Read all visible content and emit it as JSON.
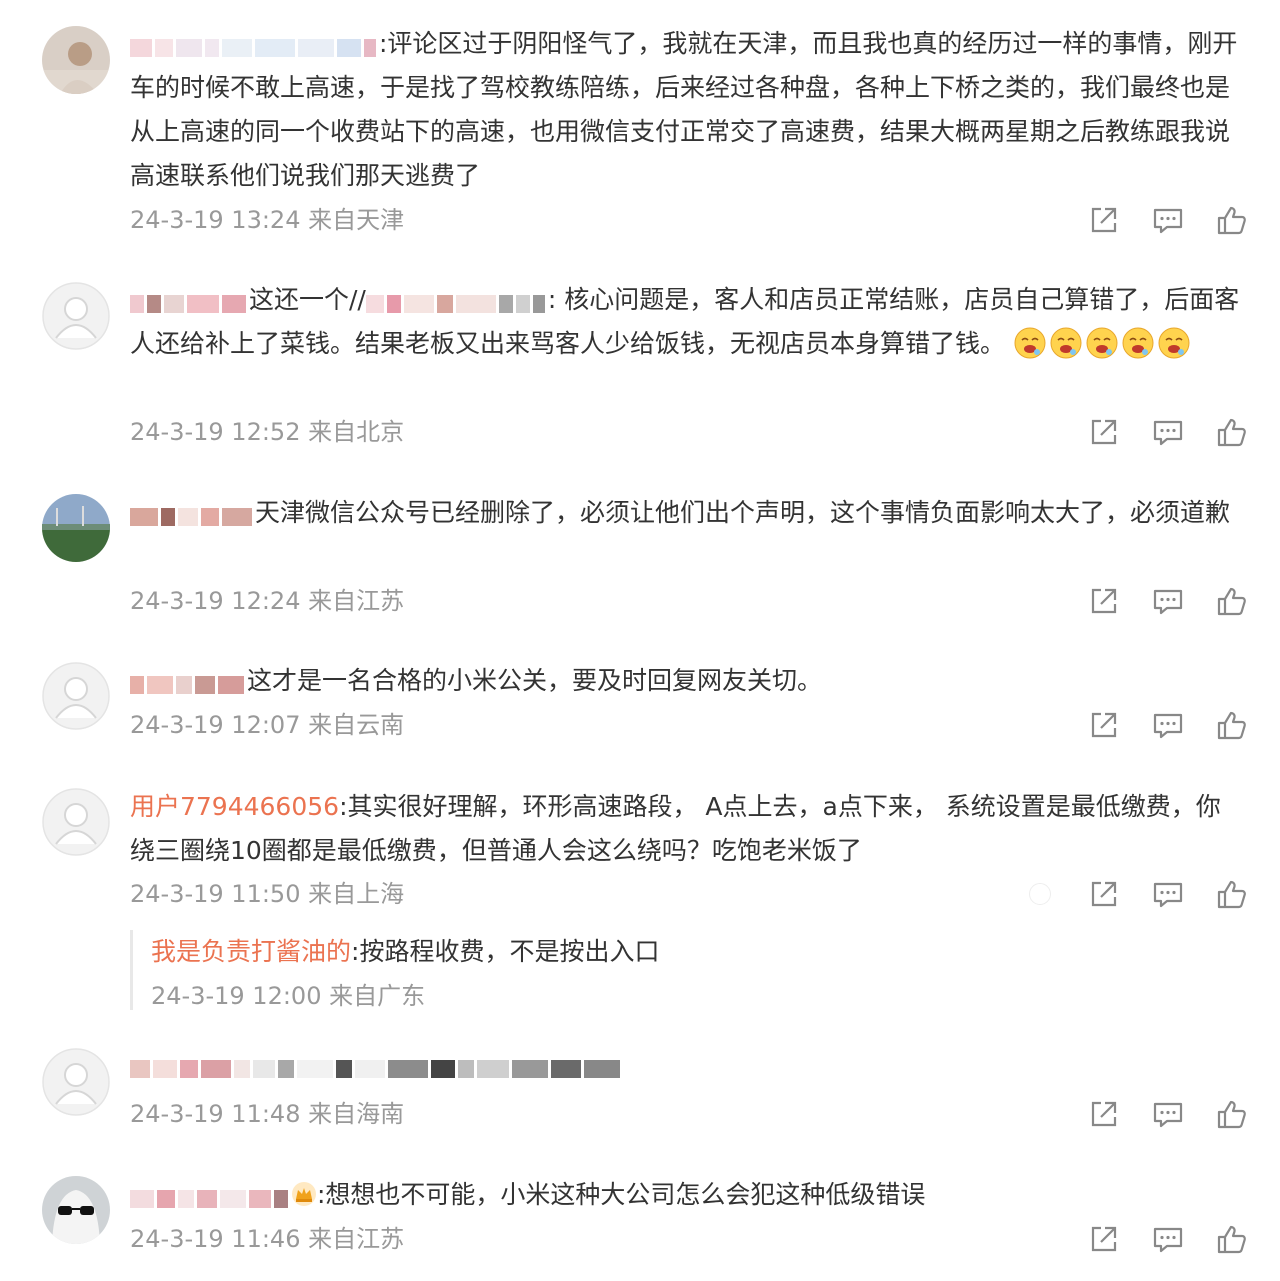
{
  "comments": [
    {
      "text": ":评论区过于阴阳怪气了，我就在天津，而且我也真的经历过一样的事情，刚开车的时候不敢上高速，于是找了驾校教练陪练，后来经过各种盘，各种上下桥之类的，我们最终也是从上高速的同一个收费站下的高速，也用微信支付正常交了高速费，结果大概两星期之后教练跟我说高速联系他们说我们那天逃费了",
      "meta": "24-3-19 13:24 来自天津"
    },
    {
      "text": "这还一个//",
      "text2": ": 核心问题是，客人和店员正常结账，店员自己算错了，后面客人还给补上了菜钱。结果老板又出来骂客人少给饭钱，无视店员本身算错了钱。",
      "meta": "24-3-19 12:52 来自北京"
    },
    {
      "text": "天津微信公众号已经删除了，必须让他们出个声明，这个事情负面影响太大了，必须道歉",
      "meta": "24-3-19 12:24 来自江苏"
    },
    {
      "text": "这才是一名合格的小米公关，要及时回复网友关切。",
      "meta": "24-3-19 12:07 来自云南"
    },
    {
      "username": "用户7794466056",
      "text": ":其实很好理解，环形高速路段， A点上去，a点下来， 系统设置是最低缴费，你绕三圈绕10圈都是最低缴费，但普通人会这么绕吗？吃饱老米饭了",
      "meta": "24-3-19 11:50 来自上海",
      "reply": {
        "username": "我是负责打酱油的",
        "text": ":按路程收费，不是按出入口",
        "meta": "24-3-19 12:00 来自广东"
      }
    },
    {
      "text": "",
      "meta": "24-3-19 11:48 来自海南"
    },
    {
      "text": ":想想也不可能，小米这种大公司怎么会犯这种低级错误",
      "meta": "24-3-19 11:46 来自江苏"
    }
  ],
  "icons": {
    "share": "share-icon",
    "comment": "comment-icon",
    "like": "like-icon",
    "report": "report-icon",
    "emoji": "drooling-face-emoji",
    "crown": "crown-badge-icon"
  },
  "colors": {
    "username": "#eb7350",
    "meta": "#999999",
    "text": "#333333",
    "icon": "#888888"
  }
}
